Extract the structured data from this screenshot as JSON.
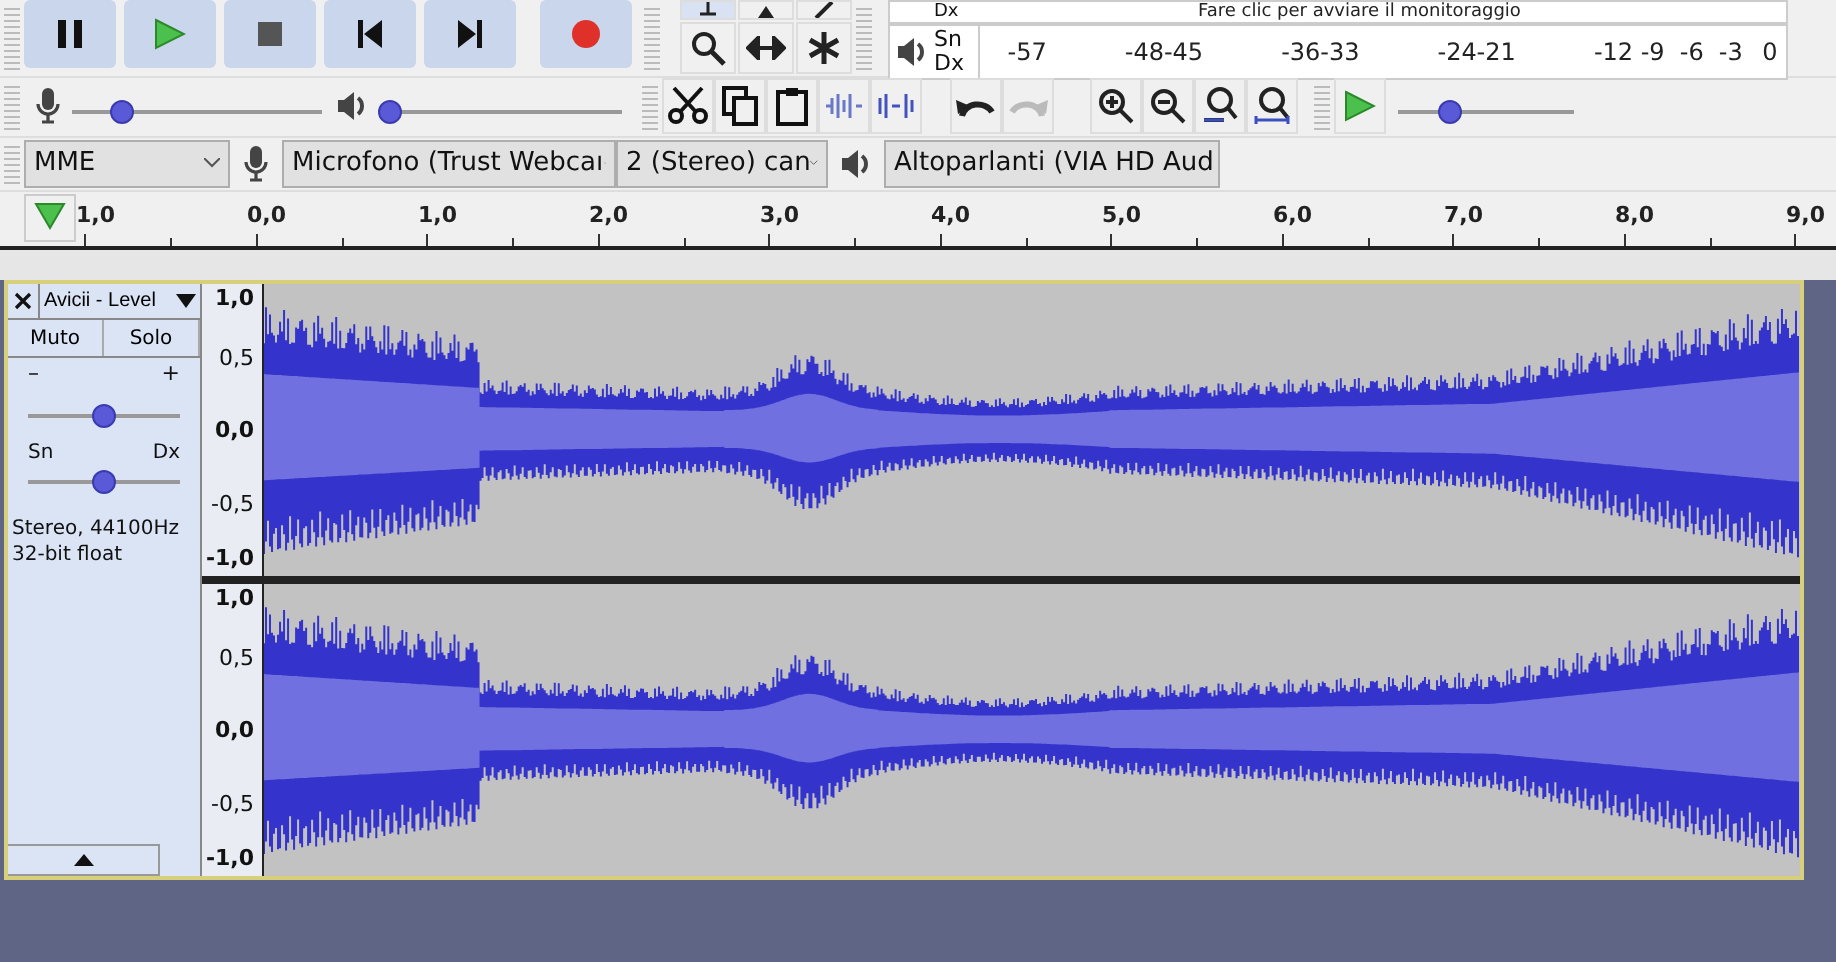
{
  "meter_toolbar": {
    "record_meter": {
      "right_label": "Dx",
      "message": "Fare clic per avviare il monitoraggio"
    },
    "playback_meter": {
      "left_label": "Sn",
      "right_label": "Dx",
      "scale": [
        "-57",
        "-48",
        "-45",
        "-36",
        "-33",
        "-24",
        "-21",
        "-12",
        "-9",
        "-6",
        "-3",
        "0"
      ]
    }
  },
  "mixer_toolbar": {
    "recording_volume": {
      "level": 0.2
    },
    "playback_volume": {
      "level": 0.03
    }
  },
  "play_at_speed": {
    "level": 0.3
  },
  "device_toolbar": {
    "host": "MME",
    "recording_device": "Microfono (Trust Webcaı",
    "channels": "2 (Stereo) can",
    "playback_device": "Altoparlanti (VIA HD Aud"
  },
  "timeline": {
    "ticks": [
      "1,0",
      "0,0",
      "1,0",
      "2,0",
      "3,0",
      "4,0",
      "5,0",
      "6,0",
      "7,0",
      "8,0",
      "9,0"
    ]
  },
  "track": {
    "name": "Avicii - Level",
    "buttons": [
      {
        "label": "Muto",
        "selected": false
      },
      {
        "label": "Solo",
        "selected": false
      }
    ],
    "gain": {
      "min_label": "–",
      "max_label": "+",
      "level": 0.5
    },
    "pan": {
      "left_label": "Sn",
      "right_label": "Dx",
      "level": 0.5
    },
    "info": [
      "Stereo, 44100Hz",
      "32-bit float"
    ],
    "channels": [
      {
        "scale": [
          "1,0",
          "0,5",
          "0,0",
          "-0,5",
          "-1,0"
        ]
      },
      {
        "scale": [
          "1,0",
          "0,5",
          "0,0",
          "-0,5",
          "-1,0"
        ]
      }
    ]
  }
}
